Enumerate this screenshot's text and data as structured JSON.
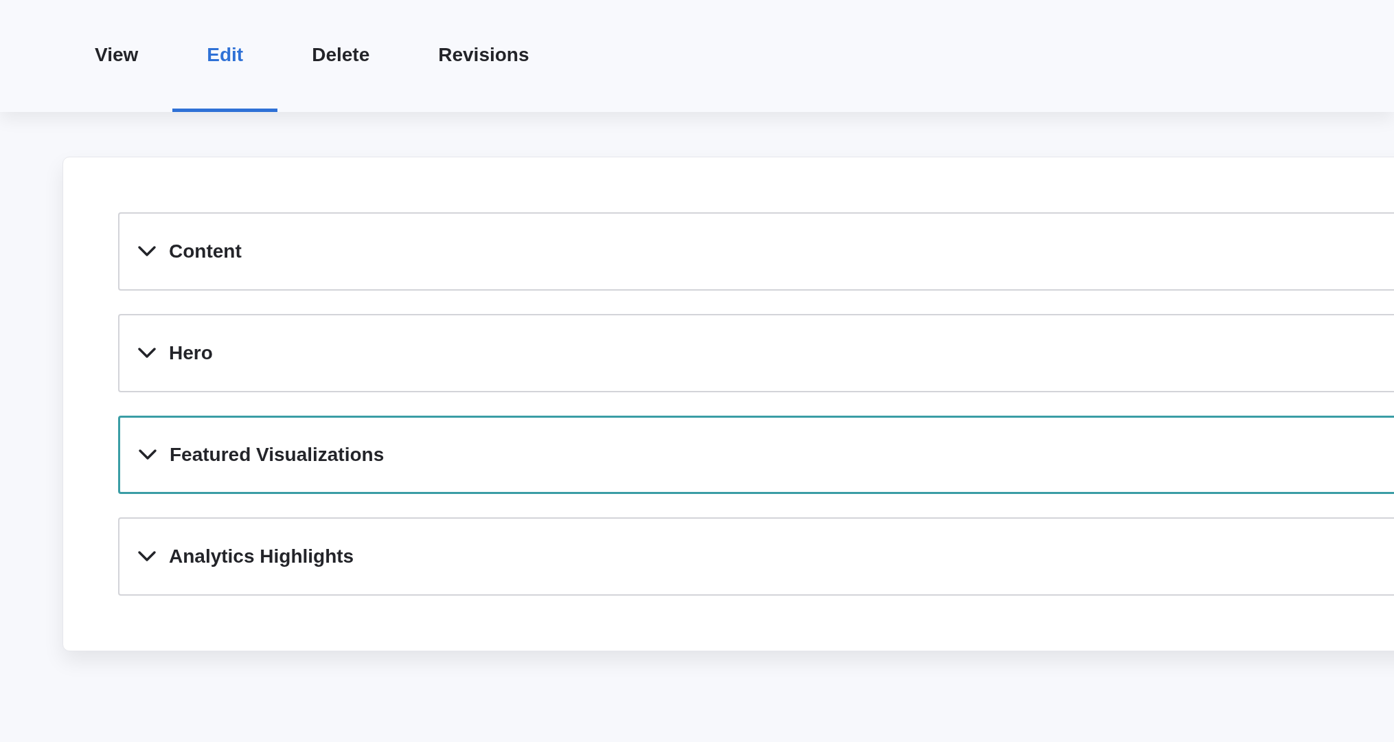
{
  "tabs": [
    {
      "label": "View",
      "selected": false
    },
    {
      "label": "Edit",
      "selected": true
    },
    {
      "label": "Delete",
      "selected": false
    },
    {
      "label": "Revisions",
      "selected": false
    }
  ],
  "sections": [
    {
      "title": "Content",
      "expanded": false,
      "focused": false
    },
    {
      "title": "Hero",
      "expanded": false,
      "focused": false
    },
    {
      "title": "Featured Visualizations",
      "expanded": false,
      "focused": true
    },
    {
      "title": "Analytics Highlights",
      "expanded": false,
      "focused": false
    }
  ]
}
